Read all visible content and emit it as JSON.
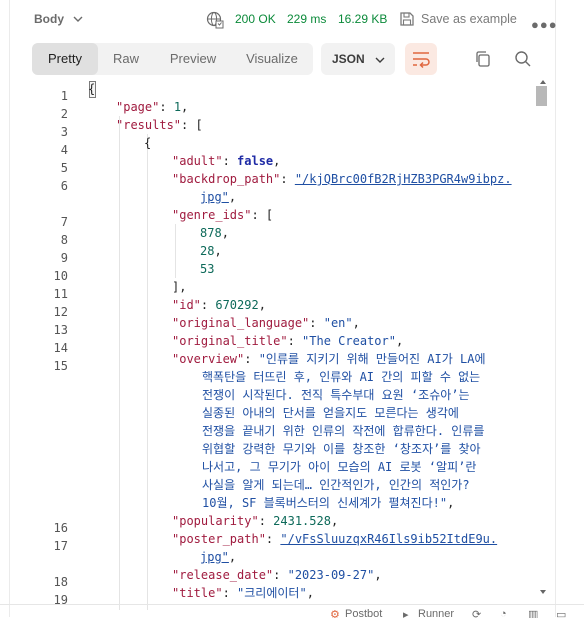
{
  "header": {
    "body_tab": "Body",
    "status": "200 OK",
    "time": "229 ms",
    "size": "16.29 KB",
    "save_label": "Save as example"
  },
  "toolbar": {
    "tabs": [
      "Pretty",
      "Raw",
      "Preview",
      "Visualize"
    ],
    "active_tab": "Pretty",
    "format": "JSON"
  },
  "code": {
    "line_numbers": [
      "1",
      "2",
      "3",
      "4",
      "5",
      "6",
      "7",
      "8",
      "9",
      "10",
      "11",
      "12",
      "13",
      "14",
      "15",
      "16",
      "17",
      "18",
      "19"
    ],
    "page_key": "\"page\"",
    "page_val": "1",
    "results_key": "\"results\"",
    "adult_key": "\"adult\"",
    "adult_val": "false",
    "backdrop_key": "\"backdrop_path\"",
    "backdrop_val_1": "\"/kjQBrc00fB2RjHZB3PGR4w9ibpz.",
    "backdrop_val_2": "jpg\"",
    "genre_key": "\"genre_ids\"",
    "genre_1": "878",
    "genre_2": "28",
    "genre_3": "53",
    "id_key": "\"id\"",
    "id_val": "670292",
    "orig_lang_key": "\"original_language\"",
    "orig_lang_val": "\"en\"",
    "orig_title_key": "\"original_title\"",
    "orig_title_val": "\"The Creator\"",
    "overview_key": "\"overview\"",
    "overview_lines": [
      "\"인류를 지키기 위해 만들어진 AI가 LA에",
      "핵폭탄을 터뜨린 후, 인류와 AI 간의 피할 수 없는",
      "전쟁이 시작된다. 전직 특수부대 요원 ‘조슈아’는",
      "실종된 아내의 단서를 얻을지도 모른다는 생각에",
      "전쟁을 끝내기 위한 인류의 작전에 합류한다. 인류를",
      "위협할 강력한 무기와 이를 창조한 ‘창조자’를 찾아",
      "나서고, 그 무기가 아이 모습의 AI 로봇 ‘알피’란",
      "사실을 알게 되는데… 인간적인가, 인간의 적인가?",
      "10월, SF 블록버스터의 신세계가 펼쳐진다!\""
    ],
    "popularity_key": "\"popularity\"",
    "popularity_val": "2431.528",
    "poster_key": "\"poster_path\"",
    "poster_val_1": "\"/vFsSluuzqxR46Ils9ib52ItdE9u.",
    "poster_val_2": "jpg\"",
    "release_key": "\"release_date\"",
    "release_val": "\"2023-09-27\"",
    "title_key": "\"title\"",
    "title_val": "\"크리에이터\""
  },
  "statusbar": {
    "postbot": "Postbot",
    "runner": "Runner"
  },
  "colors": {
    "ok_green": "#0b8a3a",
    "key_red": "#a01b3f",
    "string_blue": "#1f4fa3",
    "number_teal": "#0e6a5a",
    "wrap_accent": "#e0663e"
  }
}
